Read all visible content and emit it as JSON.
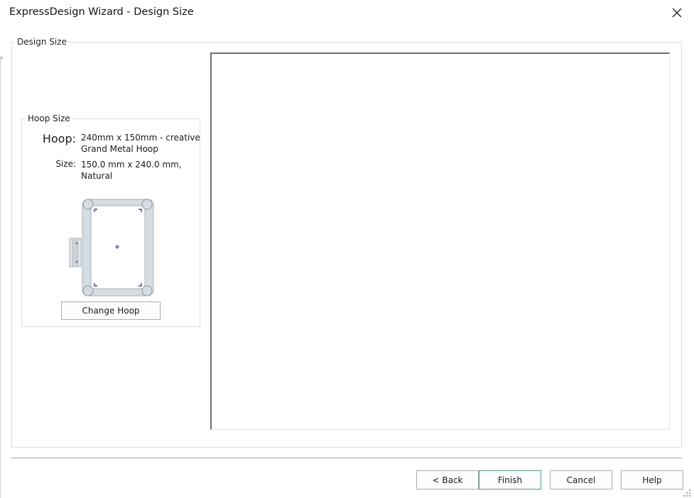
{
  "window": {
    "title": "ExpressDesign Wizard - Design Size",
    "close_icon": "close-icon"
  },
  "design_size_group": {
    "legend": "Design Size"
  },
  "hoop_size_group": {
    "legend": "Hoop Size",
    "hoop_label": "Hoop:",
    "hoop_value": "240mm x 150mm - creative Grand Metal Hoop",
    "size_label": "Size:",
    "size_value": "150.0 mm x 240.0 mm, Natural",
    "change_hoop_button": "Change Hoop",
    "hoop_icon": "hoop-diagram-icon"
  },
  "footer": {
    "back_button": "< Back",
    "finish_button": "Finish",
    "cancel_button": "Cancel",
    "help_button": "Help"
  },
  "colors": {
    "finish_border": "#48a08c",
    "hoop_frame": "#d6dde2",
    "hoop_marker": "#1a1aa0"
  }
}
